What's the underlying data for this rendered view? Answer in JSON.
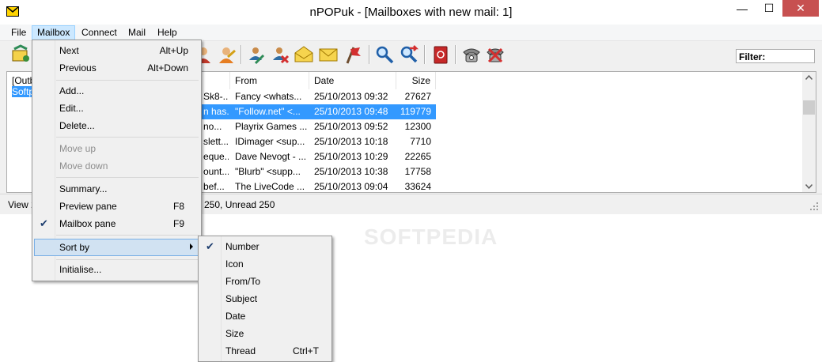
{
  "window": {
    "title": "nPOPuk - [Mailboxes with new mail: 1]",
    "controls": {
      "minimize": "—",
      "maximize": "☐",
      "close": "✕"
    }
  },
  "menubar": [
    "File",
    "Mailbox",
    "Connect",
    "Mail",
    "Help"
  ],
  "toolbar": {
    "icons": [
      "check-send-receive-icon",
      "user-icon-1",
      "user-icon-2",
      "check-mail-icon",
      "delete-mail-icon",
      "envelope-open-icon",
      "envelope-icon",
      "flag-icon",
      "search-icon",
      "search-next-icon",
      "address-book-icon",
      "dial-up-icon",
      "disconnect-icon"
    ],
    "filter_label": "Filter:"
  },
  "mailbox_list": [
    "[Outb",
    "Softp"
  ],
  "message_list": {
    "columns": [
      "From",
      "Date",
      "Size"
    ],
    "rows": [
      {
        "subject": "Sk8-...",
        "from": "Fancy <whats...",
        "date": "25/10/2013 09:32",
        "size": "27627",
        "selected": false
      },
      {
        "subject": "n has...",
        "from": "\"Follow.net\" <...",
        "date": "25/10/2013 09:48",
        "size": "119779",
        "selected": true
      },
      {
        "subject": "no...",
        "from": "Playrix Games ...",
        "date": "25/10/2013 09:52",
        "size": "12300",
        "selected": false
      },
      {
        "subject": "slett...",
        "from": "IDimager <sup...",
        "date": "25/10/2013 10:18",
        "size": "7710",
        "selected": false
      },
      {
        "subject": "eque...",
        "from": "Dave Nevogt - ...",
        "date": "25/10/2013 10:29",
        "size": "22265",
        "selected": false
      },
      {
        "subject": "ount...",
        "from": "\"Blurb\" <supp...",
        "date": "25/10/2013 10:38",
        "size": "17758",
        "selected": false
      },
      {
        "subject": "bef...",
        "from": "The LiveCode ...",
        "date": "25/10/2013 09:04",
        "size": "33624",
        "selected": false
      }
    ]
  },
  "statusbar": {
    "left": "View 2",
    "right": "250, Unread 250"
  },
  "mailbox_menu": {
    "items": [
      {
        "label": "Next",
        "shortcut": "Alt+Up"
      },
      {
        "label": "Previous",
        "shortcut": "Alt+Down"
      },
      {
        "label": "Add...",
        "shortcut": ""
      },
      {
        "label": "Edit...",
        "shortcut": ""
      },
      {
        "label": "Delete...",
        "shortcut": ""
      },
      {
        "label": "Move up",
        "shortcut": "",
        "disabled": true
      },
      {
        "label": "Move down",
        "shortcut": "",
        "disabled": true
      },
      {
        "label": "Summary...",
        "shortcut": ""
      },
      {
        "label": "Preview pane",
        "shortcut": "F8"
      },
      {
        "label": "Mailbox pane",
        "shortcut": "F9",
        "checked": true
      },
      {
        "label": "Sort by",
        "shortcut": "",
        "submenu": true
      },
      {
        "label": "Initialise...",
        "shortcut": ""
      }
    ],
    "check_glyph": "✔"
  },
  "sort_menu": {
    "items": [
      {
        "label": "Number",
        "shortcut": "",
        "checked": true
      },
      {
        "label": "Icon",
        "shortcut": ""
      },
      {
        "label": "From/To",
        "shortcut": ""
      },
      {
        "label": "Subject",
        "shortcut": ""
      },
      {
        "label": "Date",
        "shortcut": ""
      },
      {
        "label": "Size",
        "shortcut": ""
      },
      {
        "label": "Thread",
        "shortcut": "Ctrl+T"
      }
    ]
  },
  "watermark": "SOFTPEDIA",
  "colors": {
    "selection": "#3399ff",
    "menu_highlight": "#d1e2f2",
    "close_button": "#c75050"
  }
}
